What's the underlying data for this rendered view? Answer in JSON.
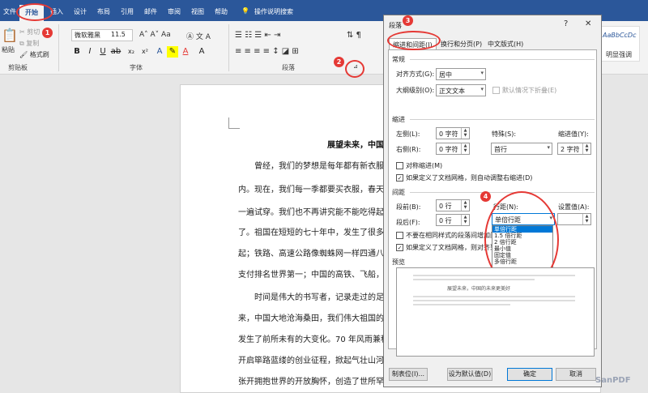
{
  "ribbon_tabs": [
    "文件",
    "开始",
    "插入",
    "设计",
    "布局",
    "引用",
    "邮件",
    "审阅",
    "视图",
    "帮助"
  ],
  "tell_me": "操作说明搜索",
  "clipboard": {
    "paste": "粘贴",
    "cut": "剪切",
    "copy": "复制",
    "format_painter": "格式刷",
    "group": "剪贴板"
  },
  "font": {
    "name": "微软雅黑",
    "size": "11.5",
    "group": "字体"
  },
  "paragraph_group": "段落",
  "styles": [
    "AaBbCcDc",
    "AaBbCcDc"
  ],
  "style_label": "明显强调",
  "document": {
    "title": "展望未来，中国",
    "lines": [
      "曾经，我们的梦想是每年都有新衣服",
      "内。现在，我们每一季都要买衣服，春天",
      "一遍试穿。我们也不再讲究能不能吃得起",
      "了。祖国在短短的七十年中，发生了很多",
      "起；铁路、高速公路像蜘蛛网一样四通八",
      "支付排名世界第一；中国的高铁、飞船，",
      "时间是伟大的书写者，记录走过的足",
      "来，中国大地沧海桑田，我们伟大祖国的",
      "发生了前所未有的大变化。70 年风雨兼程",
      "开启筚路蓝缕的创业征程，掀起气壮山河",
      "张开拥抱世界的开放胸怀，创造了世所罕"
    ]
  },
  "badges": [
    "1",
    "2",
    "3",
    "4"
  ],
  "dialog": {
    "title": "段落",
    "help": "?",
    "close": "✕",
    "tabs": [
      "缩进和间距(I)",
      "换行和分页(P)",
      "中文版式(H)"
    ],
    "general": {
      "heading": "常规",
      "alignment_label": "对齐方式(G):",
      "alignment_value": "居中",
      "outline_label": "大纲级别(O):",
      "outline_value": "正文文本",
      "collapsed_label": "默认情况下折叠(E)"
    },
    "indent": {
      "heading": "缩进",
      "left_label": "左侧(L):",
      "left_value": "0 字符",
      "right_label": "右侧(R):",
      "right_value": "0 字符",
      "special_label": "特殊(S):",
      "special_value": "首行",
      "indent_by_label": "缩进值(Y):",
      "indent_by_value": "2 字符",
      "mirror_label": "对称缩进(M)",
      "grid_label": "如果定义了文档网格，则自动调整右缩进(D)"
    },
    "spacing": {
      "heading": "间距",
      "before_label": "段前(B):",
      "before_value": "0 行",
      "after_label": "段后(F):",
      "after_value": "0 行",
      "line_spacing_label": "行距(N):",
      "line_spacing_value": "单倍行距",
      "at_label": "设置值(A):",
      "no_space_label": "不要在相同样式的段落间增加间距",
      "grid_label": "如果定义了文档网格，则对齐到网格",
      "options": [
        "单倍行距",
        "1.5 倍行距",
        "2 倍行距",
        "最小值",
        "固定值",
        "多倍行距"
      ]
    },
    "preview": {
      "heading": "预览",
      "sample_title": "展望未来，中国的未来更美好"
    },
    "buttons": {
      "tabs": "制表位(I)...",
      "default": "设为默认值(D)",
      "ok": "确定",
      "cancel": "取消"
    }
  },
  "watermark": "SanPDF",
  "colors": {
    "ribbon": "#2b579a",
    "highlight": "#e53935",
    "select": "#0078d7"
  }
}
